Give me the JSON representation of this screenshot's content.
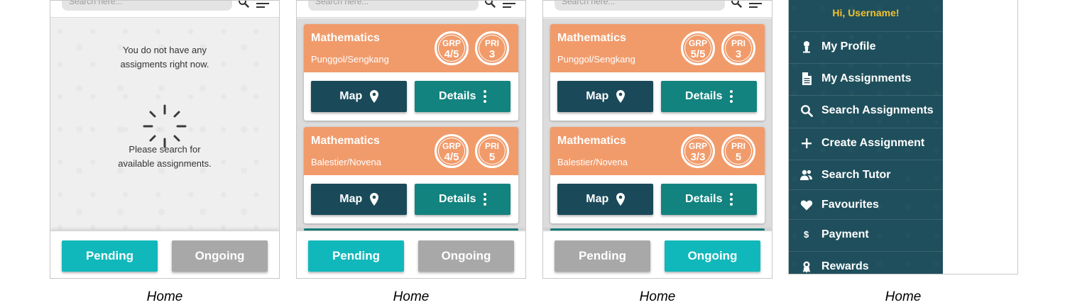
{
  "search": {
    "placeholder": "Search here..."
  },
  "tabs": {
    "pending": "Pending",
    "ongoing": "Ongoing"
  },
  "screen1": {
    "empty_message": "You do not have any\nassigments right now.",
    "search_hint": "Please search for\navailable assignments."
  },
  "screen2": {
    "cards": [
      {
        "subject": "Mathematics",
        "area": "Punggol/Sengkang",
        "grp_label": "GRP",
        "grp_value": "4/5",
        "pri_label": "PRI",
        "pri_value": "3",
        "map_label": "Map",
        "details_label": "Details"
      },
      {
        "subject": "Mathematics",
        "area": "Balestier/Novena",
        "grp_label": "GRP",
        "grp_value": "4/5",
        "pri_label": "PRI",
        "pri_value": "5",
        "map_label": "Map",
        "details_label": "Details"
      }
    ]
  },
  "screen3": {
    "cards": [
      {
        "subject": "Mathematics",
        "area": "Punggol/Sengkang",
        "grp_label": "GRP",
        "grp_value": "5/5",
        "pri_label": "PRI",
        "pri_value": "3",
        "map_label": "Map",
        "details_label": "Details"
      },
      {
        "subject": "Mathematics",
        "area": "Balestier/Novena",
        "grp_label": "GRP",
        "grp_value": "3/3",
        "pri_label": "PRI",
        "pri_value": "5",
        "map_label": "Map",
        "details_label": "Details"
      }
    ]
  },
  "drawer": {
    "greeting": "Hi, Username!",
    "items": [
      {
        "label": "My Profile",
        "icon": "person-icon"
      },
      {
        "label": "My Assignments",
        "icon": "document-icon"
      },
      {
        "label": "Search Assignments",
        "icon": "search-icon"
      },
      {
        "label": "Create Assignment",
        "icon": "plus-icon"
      },
      {
        "label": "Search Tutor",
        "icon": "people-icon"
      },
      {
        "label": "Favourites",
        "icon": "heart-icon"
      },
      {
        "label": "Payment",
        "icon": "dollar-icon"
      },
      {
        "label": "Rewards",
        "icon": "ribbon-icon"
      }
    ]
  },
  "captions": [
    "Home",
    "Home",
    "Home",
    "Home"
  ],
  "colors": {
    "card_header": "#f19b6b",
    "map_button": "#1a4a5a",
    "details_button": "#13837f",
    "tab_active": "#11b8bb",
    "tab_inactive": "#a8a8a8",
    "drawer_bg": "#1f4f5c",
    "greeting": "#f2c230"
  }
}
